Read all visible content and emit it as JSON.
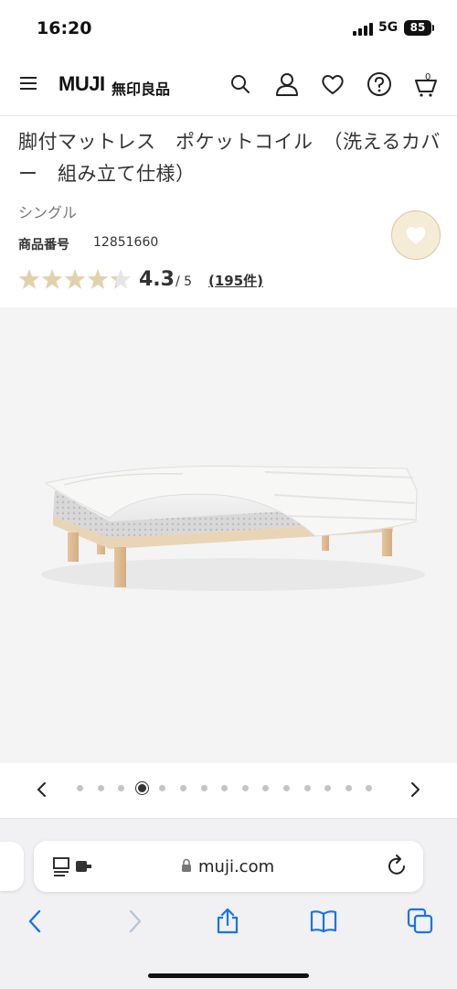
{
  "status": {
    "time": "16:20",
    "network": "5G",
    "battery": "85"
  },
  "header": {
    "logo": "MUJI",
    "logo_jp": "無印良品",
    "cart_count": "0",
    "icons": [
      "menu-icon",
      "search-icon",
      "account-icon",
      "heart-icon",
      "help-icon",
      "cart-icon"
    ]
  },
  "product": {
    "title": "脚付マットレス　ポケットコイル　（洗えるカバー　組み立て仕様）",
    "size": "シングル",
    "code_label": "商品番号",
    "code": "12851660",
    "rating": "4.3",
    "rating_max": "/ 5",
    "rating_value": 4.3,
    "reviews": "(195件)"
  },
  "carousel": {
    "count": 15,
    "active_index": 3
  },
  "browser": {
    "url": "muji.com"
  },
  "colors": {
    "accent": "#d9c79f",
    "favorite_bg": "#f5ecd8",
    "star_filled": "#e2d2ac",
    "star_empty": "#e6e6e6",
    "browser_blue": "#1a73e8"
  }
}
